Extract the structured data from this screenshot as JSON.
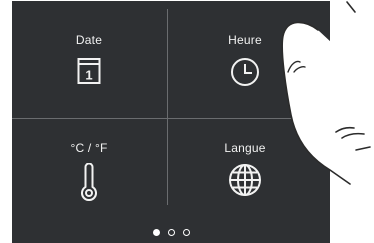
{
  "tiles": {
    "date": {
      "label": "Date",
      "icon": "calendar-icon",
      "day": "1"
    },
    "heure": {
      "label": "Heure",
      "icon": "clock-icon"
    },
    "temperature": {
      "label": "°C / °F",
      "icon": "thermometer-icon"
    },
    "langue": {
      "label": "Langue",
      "icon": "globe-icon"
    }
  },
  "pager": {
    "pages": 3,
    "active_index": 0
  },
  "colors": {
    "screen_bg": "#2e3033",
    "divider": "#6a6c6f",
    "foreground": "#f2f2f2"
  }
}
